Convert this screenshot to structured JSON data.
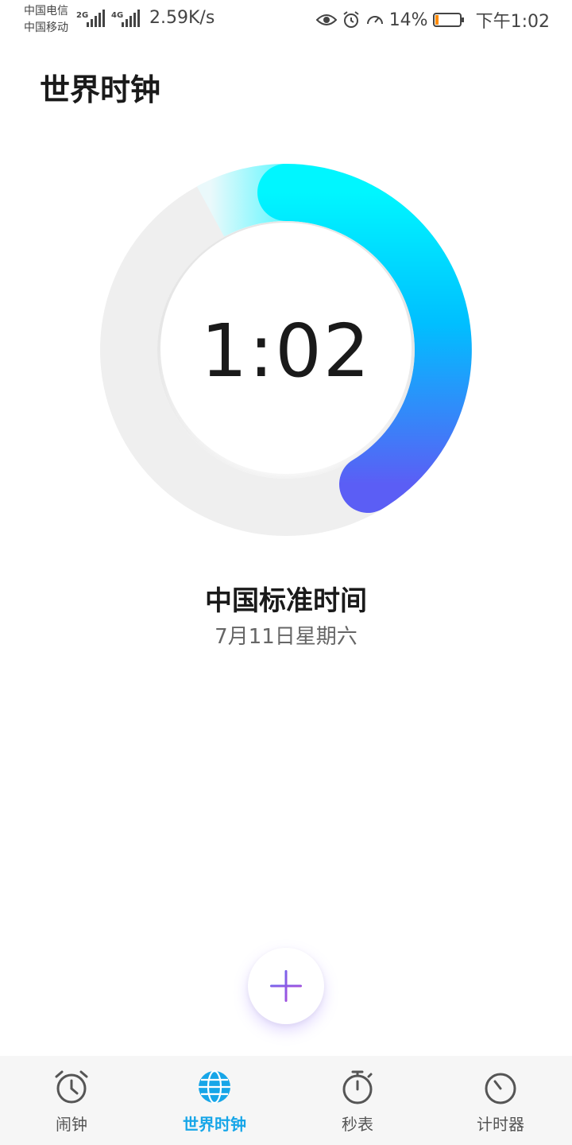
{
  "status_bar": {
    "carrier_1": "中国电信",
    "carrier_2": "中国移动",
    "net_1": "2G",
    "net_2": "4G",
    "net_speed": "2.59K/s",
    "battery_percent": "14%",
    "battery_level": 0.14,
    "time": "下午1:02"
  },
  "page": {
    "title": "世界时钟"
  },
  "clock": {
    "time": "1:02",
    "city": "中国标准时间",
    "date": "7月11日星期六"
  },
  "nav": {
    "items": [
      {
        "label": "闹钟",
        "icon": "alarm-clock-icon",
        "active": false
      },
      {
        "label": "世界时钟",
        "icon": "globe-icon",
        "active": true
      },
      {
        "label": "秒表",
        "icon": "stopwatch-icon",
        "active": false
      },
      {
        "label": "计时器",
        "icon": "timer-icon",
        "active": false
      }
    ]
  },
  "colors": {
    "accent": "#17a6e8",
    "ring_start": "#00f0ff",
    "ring_end": "#5b63f5"
  }
}
